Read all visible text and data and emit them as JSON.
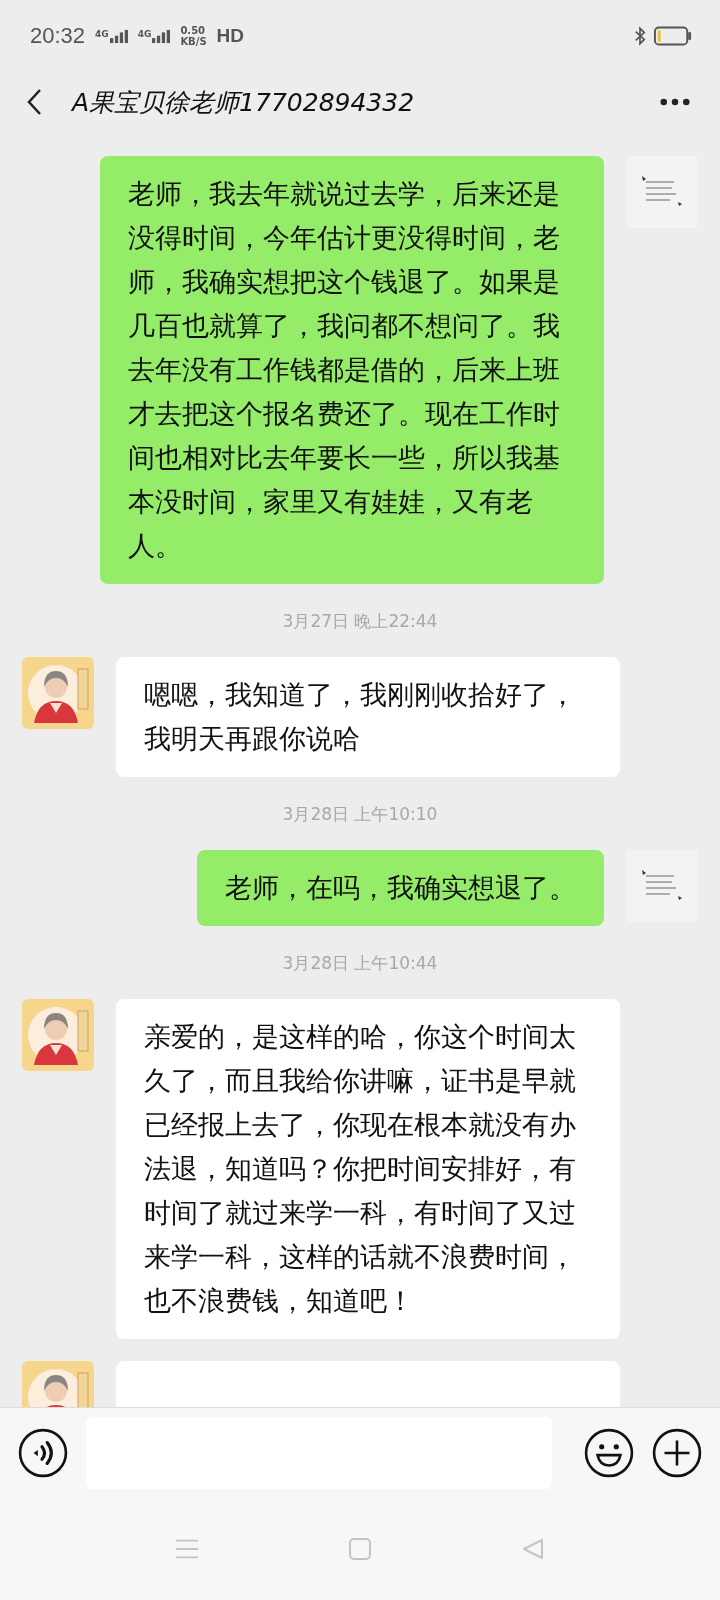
{
  "status_bar": {
    "time": "20:32",
    "network_1": "4G",
    "network_2": "4G",
    "speed": "0.50",
    "speed_unit": "KB/S",
    "hd": "HD"
  },
  "header": {
    "title": "A果宝贝徐老师17702894332"
  },
  "messages": [
    {
      "kind": "sent",
      "text": "老师，我去年就说过去学，后来还是没得时间，今年估计更没得时间，老师，我确实想把这个钱退了。如果是几百也就算了，我问都不想问了。我去年没有工作钱都是借的，后来上班才去把这个报名费还了。现在工作时间也相对比去年要长一些，所以我基本没时间，家里又有娃娃，又有老人。"
    },
    {
      "kind": "time",
      "text": "3月27日 晚上22:44"
    },
    {
      "kind": "received",
      "text": "嗯嗯，我知道了，我刚刚收拾好了，我明天再跟你说哈"
    },
    {
      "kind": "time",
      "text": "3月28日 上午10:10"
    },
    {
      "kind": "sent",
      "text": "老师，在吗，我确实想退了。"
    },
    {
      "kind": "time",
      "text": "3月28日 上午10:44"
    },
    {
      "kind": "received",
      "text": "亲爱的，是这样的哈，你这个时间太久了，而且我给你讲嘛，证书是早就已经报上去了，你现在根本就没有办法退，知道吗？你把时间安排好，有时间了就过来学一科，有时间了又过来学一科，这样的话就不浪费时间，也不浪费钱，知道吧！"
    },
    {
      "kind": "received_cut"
    }
  ]
}
